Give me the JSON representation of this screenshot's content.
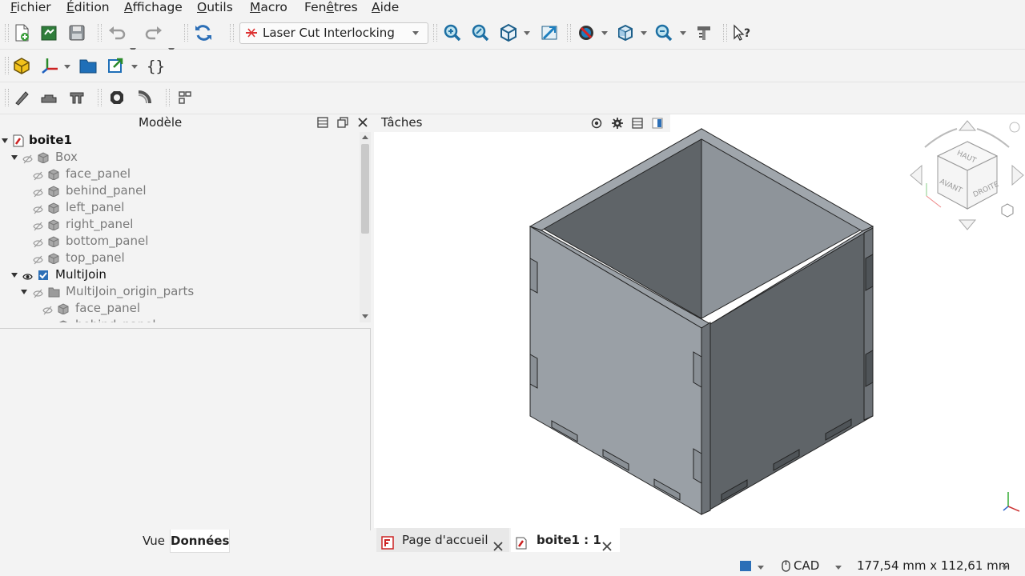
{
  "menubar": {
    "items": [
      {
        "accel": "F",
        "rest": "ichier"
      },
      {
        "accel": "É",
        "rest": "dition"
      },
      {
        "accel": "A",
        "rest": "ffichage"
      },
      {
        "accel": "O",
        "rest": "utils"
      },
      {
        "accel": "M",
        "rest": "acro"
      },
      {
        "accel": "",
        "pre": "Fen",
        "accel2": "ê",
        "rest": "tres"
      },
      {
        "accel": "A",
        "rest": "ide"
      }
    ]
  },
  "toolbar": {
    "workbench_label": "Laser Cut Interlocking"
  },
  "model_panel": {
    "title": "Modèle",
    "tabs": {
      "view": "Vue",
      "data": "Données"
    }
  },
  "tree": {
    "root": "boite1",
    "box": "Box",
    "box_children": [
      "face_panel",
      "behind_panel",
      "left_panel",
      "right_panel",
      "bottom_panel",
      "top_panel"
    ],
    "multijoin": "MultiJoin",
    "origin_parts": "MultiJoin_origin_parts",
    "origin_children": [
      "face_panel",
      "behind_panel"
    ]
  },
  "tasks_panel": {
    "title": "Tâches"
  },
  "navcube": {
    "top": "HAUT",
    "front": "AVANT",
    "right": "DROITE"
  },
  "doc_tabs": [
    {
      "label": "Page d'accueil"
    },
    {
      "label": "boite1 : 1"
    }
  ],
  "statusbar": {
    "nav_style": "CAD",
    "dimensions": "177,54 mm x 112,61 mm"
  },
  "colors": {
    "accent_blue": "#2c6fb7",
    "panel_bg": "#f3f3f3",
    "box_light": "#9aa0a6",
    "box_dark": "#5f6468"
  }
}
